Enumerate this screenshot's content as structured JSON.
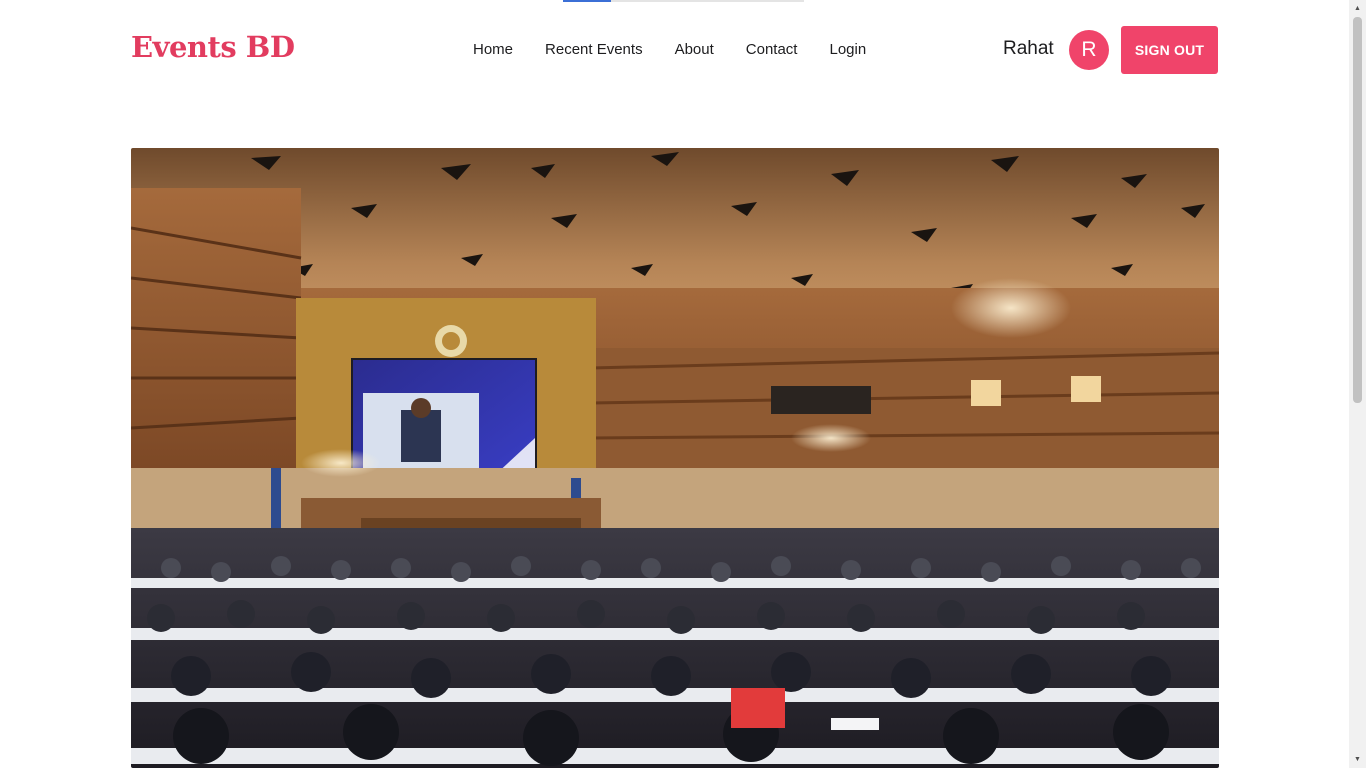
{
  "loading_bar": {
    "progress": 0.2
  },
  "brand": {
    "name": "Events BD",
    "color": "#e23c5f"
  },
  "nav": {
    "links": [
      {
        "label": "Home"
      },
      {
        "label": "Recent Events"
      },
      {
        "label": "About"
      },
      {
        "label": "Contact"
      },
      {
        "label": "Login"
      }
    ]
  },
  "user": {
    "name": "Rahat",
    "initial": "R"
  },
  "actions": {
    "sign_out_label": "SIGN OUT"
  },
  "colors": {
    "accent": "#f0446a",
    "text": "#1d1d1f"
  },
  "hero": {
    "image_description": "Conference hall with delegates and a large presentation screen"
  },
  "icons": {
    "scroll_up": "triangle-up",
    "scroll_down": "triangle-down"
  }
}
